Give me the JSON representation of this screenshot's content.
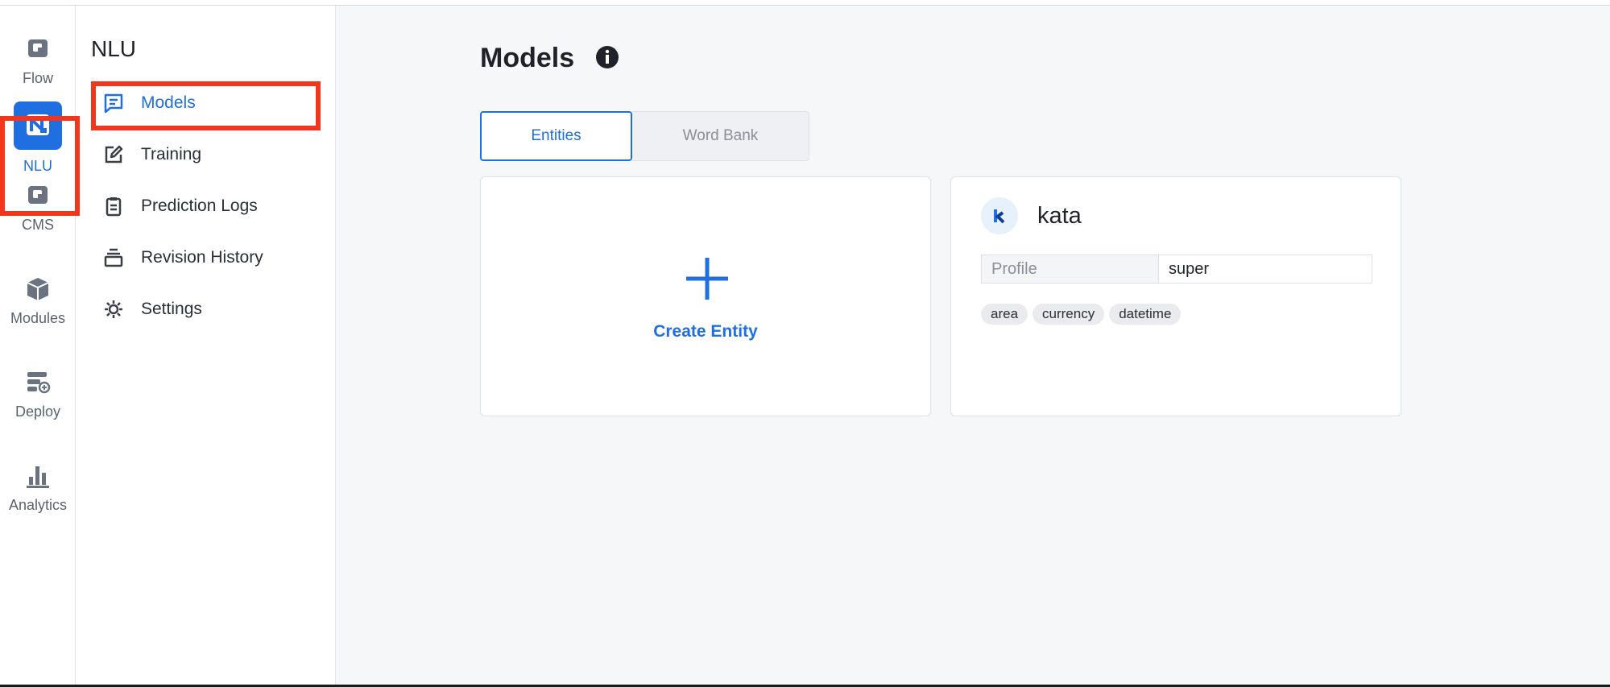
{
  "rail": {
    "items": [
      {
        "label": "Flow",
        "icon": "flow-icon"
      },
      {
        "label": "NLU",
        "icon": "nlu-icon",
        "active": true
      },
      {
        "label": "CMS",
        "icon": "cms-icon"
      },
      {
        "label": "Modules",
        "icon": "modules-icon"
      },
      {
        "label": "Deploy",
        "icon": "deploy-icon"
      },
      {
        "label": "Analytics",
        "icon": "analytics-icon"
      }
    ]
  },
  "sidebar": {
    "title": "NLU",
    "items": [
      {
        "label": "Models",
        "icon": "chat-icon",
        "active": true
      },
      {
        "label": "Training",
        "icon": "edit-icon"
      },
      {
        "label": "Prediction Logs",
        "icon": "clipboard-icon"
      },
      {
        "label": "Revision History",
        "icon": "stack-icon"
      },
      {
        "label": "Settings",
        "icon": "gear-icon"
      }
    ]
  },
  "main": {
    "title": "Models",
    "info_icon": "info-icon",
    "tabs": [
      {
        "label": "Entities",
        "active": true
      },
      {
        "label": "Word Bank",
        "active": false
      }
    ],
    "create_card": {
      "label": "Create Entity",
      "icon": "plus-icon"
    },
    "kata_card": {
      "name": "kata",
      "avatar_icon": "kata-logo-icon",
      "profile_key": "Profile",
      "profile_value": "super",
      "tags": [
        "area",
        "currency",
        "datetime"
      ]
    }
  },
  "colors": {
    "accent": "#1f6fe0",
    "highlight": "#f2361d",
    "main_bg": "#f6f7f9"
  }
}
